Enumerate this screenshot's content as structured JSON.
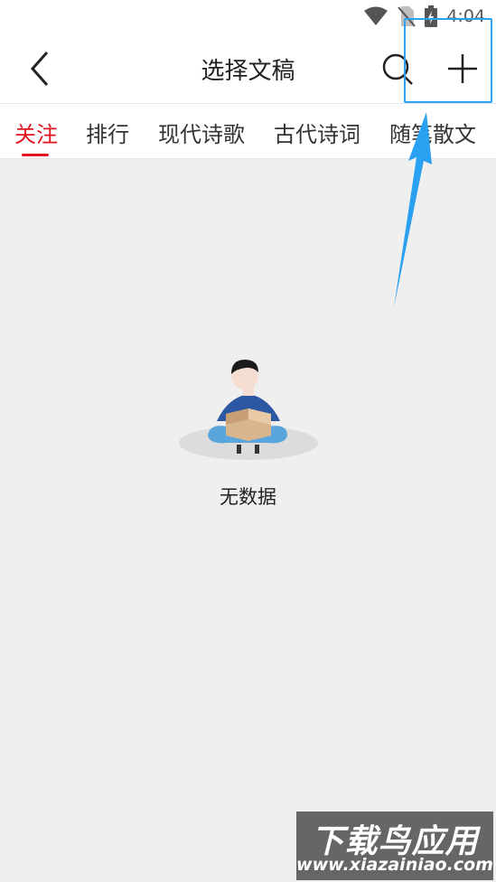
{
  "status_bar": {
    "time": "4:04"
  },
  "header": {
    "title": "选择文稿"
  },
  "tabs": [
    {
      "label": "关注",
      "active": true
    },
    {
      "label": "排行",
      "active": false
    },
    {
      "label": "现代诗歌",
      "active": false
    },
    {
      "label": "古代诗词",
      "active": false
    },
    {
      "label": "随笔散文",
      "active": false
    }
  ],
  "empty_state": {
    "message": "无数据"
  },
  "watermark": {
    "title": "下载鸟应用",
    "url": "www.xiazainiao.com"
  },
  "colors": {
    "accent": "#e0131e",
    "background": "#efefef",
    "annotation": "#2aa0f0",
    "figure_shirt": "#2c57a3",
    "figure_pants": "#5aa6dc",
    "box": "#d9b58e"
  },
  "icons": {
    "back": "chevron-left-icon",
    "search": "search-icon",
    "add": "plus-icon",
    "wifi": "wifi-icon",
    "no_sim": "no-sim-icon",
    "battery": "battery-charging-icon"
  }
}
